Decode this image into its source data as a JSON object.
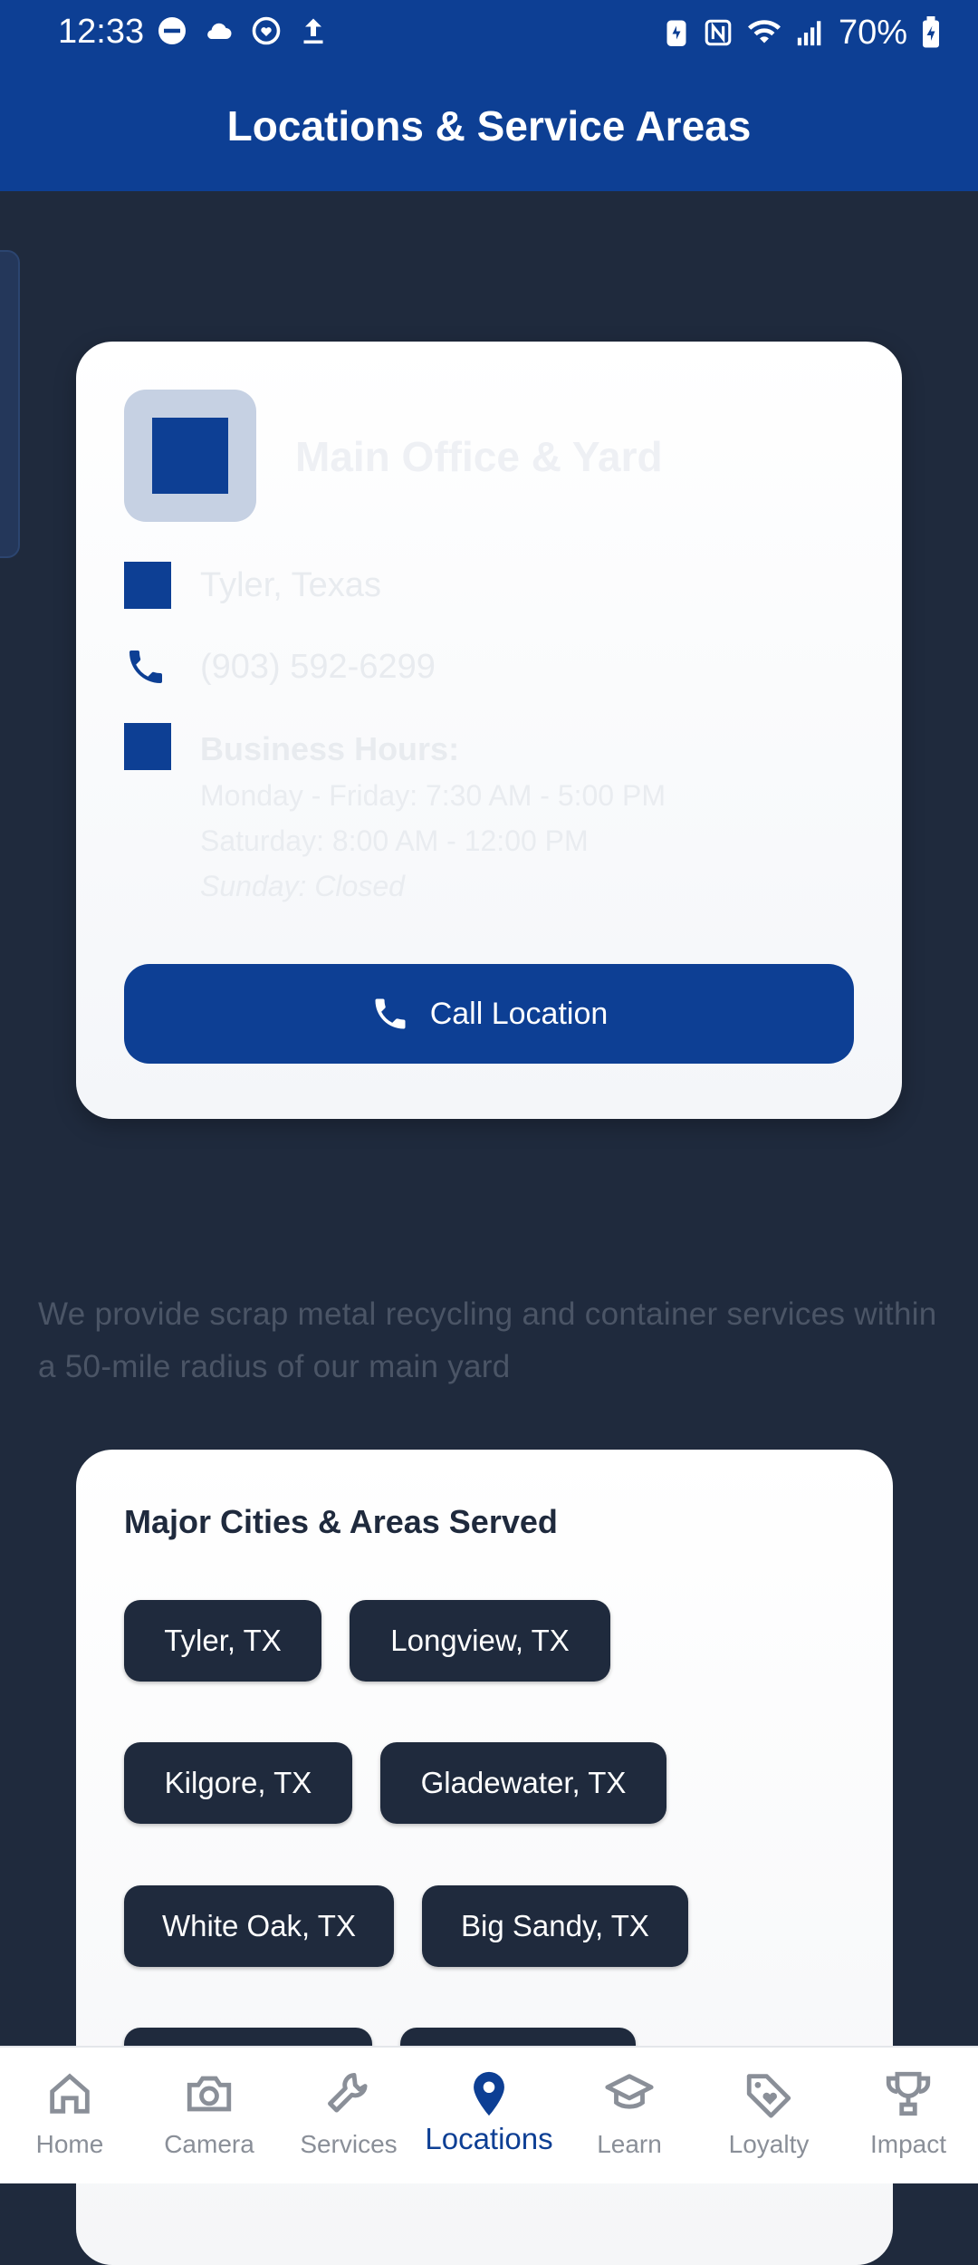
{
  "status_bar": {
    "time": "12:33",
    "battery": "70%"
  },
  "header": {
    "title": "Locations & Service Areas"
  },
  "location": {
    "name": "Main Office & Yard",
    "city": "Tyler, Texas",
    "phone": "(903) 592-6299",
    "hours_title": "Business Hours:",
    "hours": [
      "Monday - Friday: 7:30 AM - 5:00 PM",
      "Saturday: 8:00 AM - 12:00 PM",
      "Sunday: Closed"
    ],
    "call_label": "Call Location"
  },
  "service_area": {
    "description": "We provide scrap metal recycling and container services within a 50-mile radius of our main yard"
  },
  "cities": {
    "title": "Major Cities & Areas Served",
    "items": [
      "Tyler, TX",
      "Longview, TX",
      "Kilgore, TX",
      "Gladewater, TX",
      "White Oak, TX",
      "Big Sandy, TX"
    ]
  },
  "nav": {
    "items": [
      {
        "label": "Home",
        "icon": "home-icon"
      },
      {
        "label": "Camera",
        "icon": "camera-icon"
      },
      {
        "label": "Services",
        "icon": "wrench-icon"
      },
      {
        "label": "Locations",
        "icon": "location-pin-icon"
      },
      {
        "label": "Learn",
        "icon": "graduation-cap-icon"
      },
      {
        "label": "Loyalty",
        "icon": "tag-heart-icon"
      },
      {
        "label": "Impact",
        "icon": "trophy-icon"
      }
    ],
    "active": "Locations"
  },
  "colors": {
    "primary": "#0d3f94",
    "background": "#1f2a3d",
    "chip": "#1f2a3d"
  }
}
